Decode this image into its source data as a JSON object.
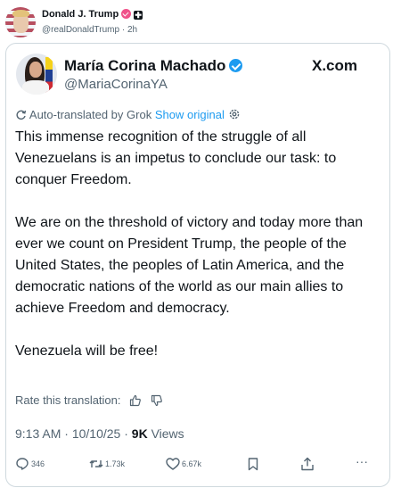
{
  "poster": {
    "name": "Donald J. Trump",
    "handle": "@realDonaldTrump",
    "time": "2h",
    "badge_char": "✚"
  },
  "card": {
    "author_name": "María Corina Machado",
    "author_handle": "@MariaCorinaYA",
    "brand": "X.com",
    "translate_label": "Auto-translated by Grok",
    "show_original": "Show original",
    "paragraphs": [
      "This immense recognition of the struggle of all Venezuelans is an impetus to conclude our task: to conquer Freedom.",
      "We are on the threshold of victory and today more than ever we count on President Trump, the people of the United States, the peoples of Latin America, and the democratic nations of the world as our main allies to achieve Freedom and democracy.",
      "Venezuela will be free!"
    ],
    "rate_label": "Rate this translation:",
    "time": "9:13 AM",
    "date": "10/10/25",
    "views_count": "9K",
    "views_label": "Views"
  },
  "actions": {
    "replies": "346",
    "reposts": "1.73k",
    "likes": "6.67k",
    "more": "···"
  },
  "colors": {
    "accent": "#1d9bf0",
    "text": "#0f1419",
    "muted": "#536471",
    "border": "#cfd9de",
    "pink_badge": "#f0528a"
  }
}
